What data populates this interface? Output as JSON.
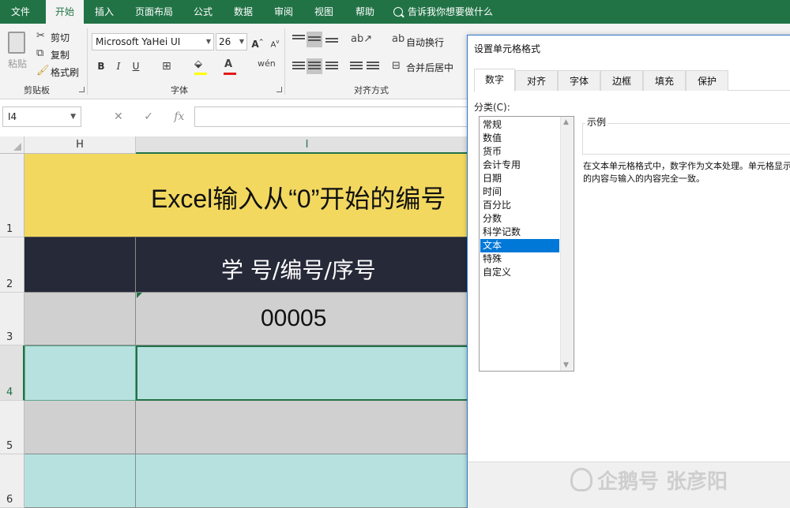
{
  "ribbon_tabs": [
    "文件",
    "开始",
    "插入",
    "页面布局",
    "公式",
    "数据",
    "审阅",
    "视图",
    "帮助"
  ],
  "tell_me": "告诉我你想要做什么",
  "clipboard": {
    "paste": "粘贴",
    "cut": "剪切",
    "copy": "复制",
    "format_painter": "格式刷",
    "group_label": "剪贴板"
  },
  "font": {
    "name": "Microsoft YaHei UI",
    "size": "26",
    "bold": "B",
    "italic": "I",
    "underline": "U",
    "group_label": "字体"
  },
  "alignment": {
    "wrap_text": "自动换行",
    "merge_center": "合并后居中",
    "group_label": "对齐方式"
  },
  "formula_bar": {
    "name_box": "I4",
    "value": ""
  },
  "columns": [
    "H",
    "I"
  ],
  "rows": [
    "1",
    "2",
    "3",
    "4",
    "5",
    "6"
  ],
  "cells": {
    "title": "Excel输入从“0”开始的编号",
    "header": "学 号/编号/序号",
    "value_row3": "00005"
  },
  "dialog": {
    "title": "设置单元格格式",
    "tabs": [
      "数字",
      "对齐",
      "字体",
      "边框",
      "填充",
      "保护"
    ],
    "active_tab": "数字",
    "category_label": "分类(C):",
    "categories": [
      "常规",
      "数值",
      "货币",
      "会计专用",
      "日期",
      "时间",
      "百分比",
      "分数",
      "科学记数",
      "文本",
      "特殊",
      "自定义"
    ],
    "selected_category": "文本",
    "sample_label": "示例",
    "description": "在文本单元格格式中，数字作为文本处理。单元格显示的内容与输入的内容完全一致。"
  },
  "watermark": "企鹅号 张彦阳",
  "colors": {
    "accent": "#217346",
    "title_fill": "#f2d85f",
    "header_fill": "#262938",
    "gray_fill": "#d0d0d0",
    "teal_fill": "#b7e1df",
    "selection": "#0078d7"
  }
}
